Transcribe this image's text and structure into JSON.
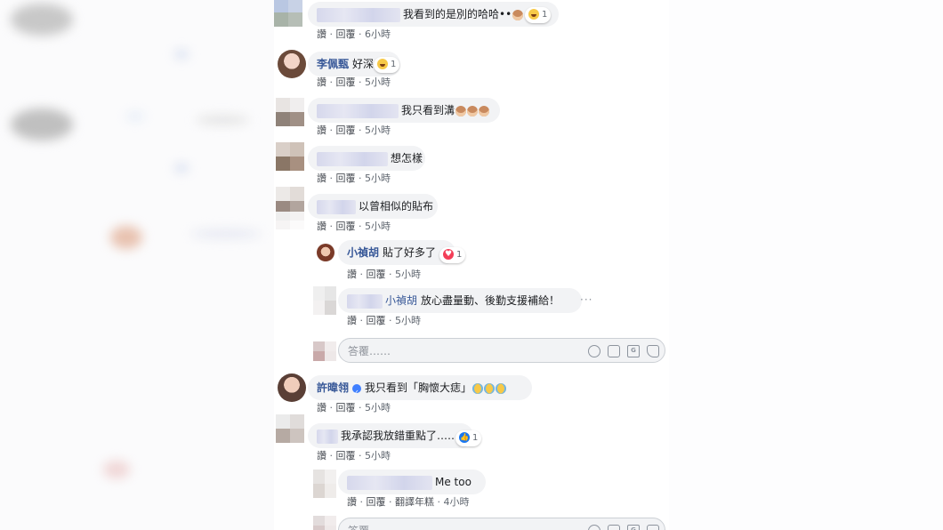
{
  "ui": {
    "like": "讚",
    "reply": "回覆",
    "see_translation": "翻譯年糕",
    "reply_placeholder": "答覆……"
  },
  "comments": [
    {
      "name": "",
      "text": "我看到的是別的哈哈••",
      "time": "6小時",
      "reaction": "1"
    },
    {
      "name": "李佩甄",
      "text": "好深",
      "time": "5小時",
      "reaction": "1"
    },
    {
      "name": "",
      "text": "我只看到溝",
      "time": "5小時"
    },
    {
      "name": "",
      "text": "想怎樣",
      "time": "5小時"
    },
    {
      "name": "",
      "text": "以曾相似的貼布",
      "time": "5小時"
    },
    {
      "name": "小禎胡",
      "text": "貼了好多了",
      "time": "5小時",
      "reaction": "1"
    },
    {
      "name": "小禎胡",
      "text": "放心盡量動、後勤支援補給！",
      "time": "5小時"
    },
    {
      "name": "許暐翎",
      "text": "我只看到「胸懷大痣」",
      "time": "5小時"
    },
    {
      "name": "",
      "text": "我承認我放錯重點了……",
      "time": "5小時",
      "reaction": "1"
    },
    {
      "name": "",
      "text": "Me too",
      "time": "4小時"
    }
  ],
  "colors": {
    "link": "#385898",
    "bubble": "#f2f3f5",
    "meta": "#606770"
  }
}
